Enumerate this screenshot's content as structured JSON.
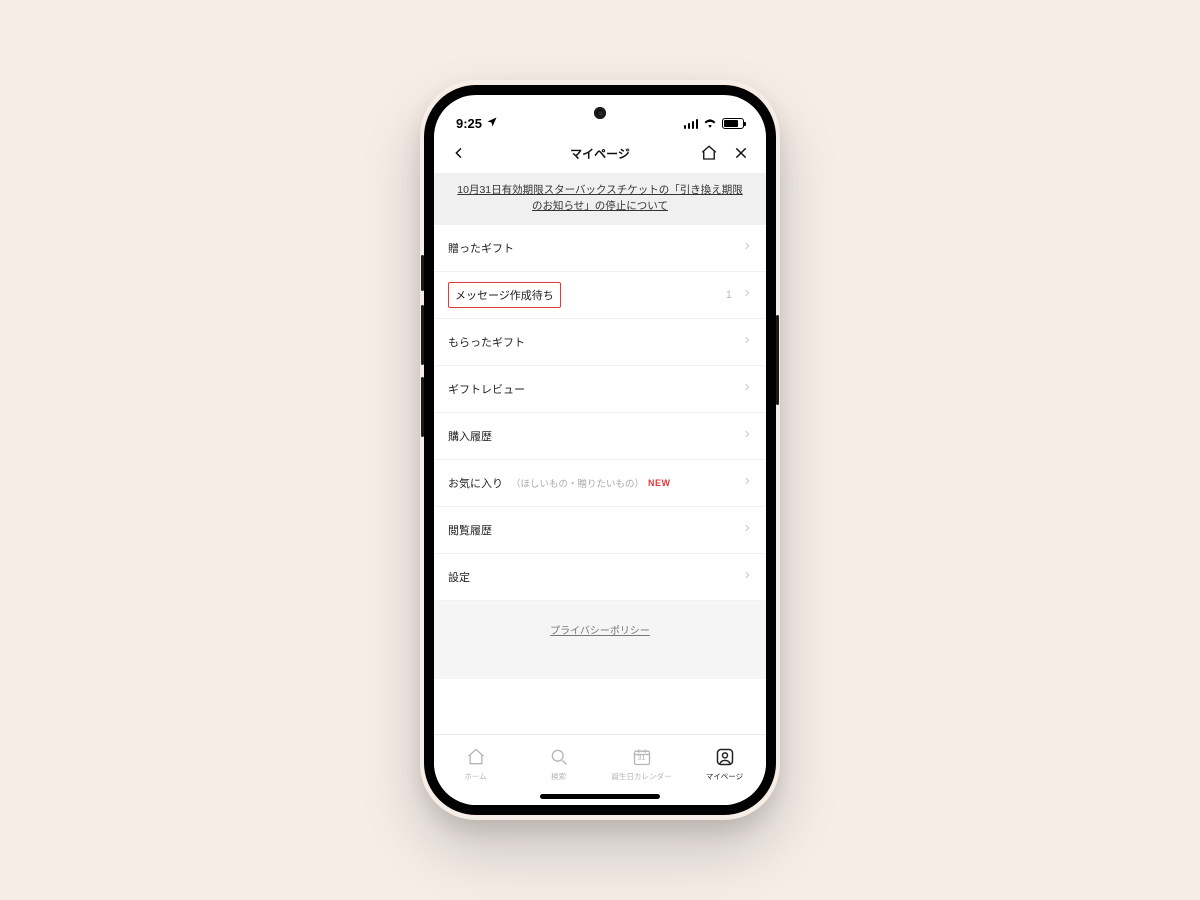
{
  "status": {
    "time": "9:25"
  },
  "nav": {
    "title": "マイページ"
  },
  "banner": {
    "line1": "10月31日有効期限スターバックスチケットの「引き換え期限",
    "line2": "のお知らせ」の停止について"
  },
  "rows": {
    "sent_gifts": {
      "label": "贈ったギフト"
    },
    "pending_message": {
      "label": "メッセージ作成待ち",
      "count": "1"
    },
    "received_gifts": {
      "label": "もらったギフト"
    },
    "gift_review": {
      "label": "ギフトレビュー"
    },
    "purchase_history": {
      "label": "購入履歴"
    },
    "favorites": {
      "label": "お気に入り",
      "sub": "（ほしいもの・贈りたいもの）",
      "new": "NEW"
    },
    "browse_history": {
      "label": "閲覧履歴"
    },
    "settings": {
      "label": "設定"
    }
  },
  "footer": {
    "privacy": "プライバシーポリシー"
  },
  "tabs": {
    "home": {
      "label": "ホーム"
    },
    "search": {
      "label": "検索"
    },
    "calendar": {
      "label": "誕生日カレンダー",
      "day": "31"
    },
    "mypage": {
      "label": "マイページ"
    }
  }
}
